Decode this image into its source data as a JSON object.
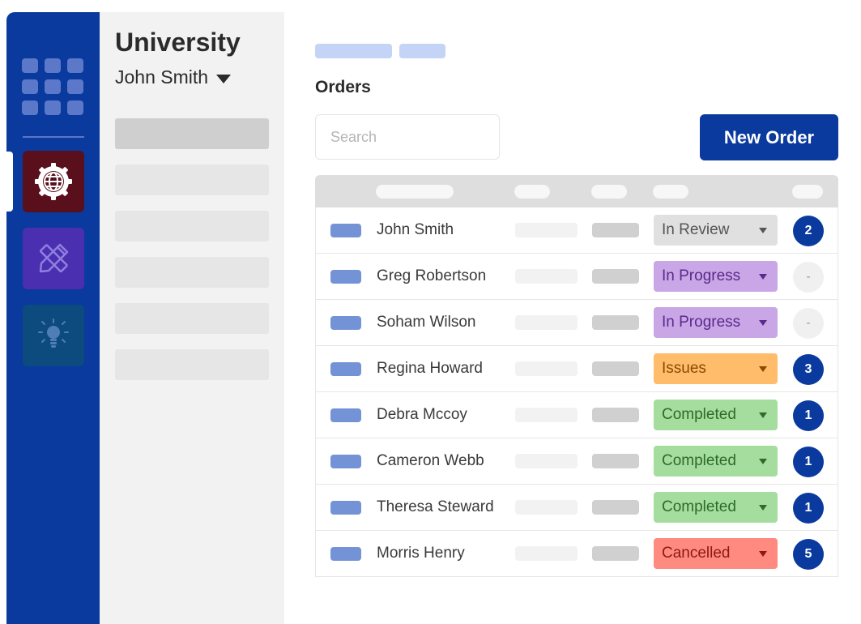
{
  "sidebar": {
    "org_title": "University",
    "user_name": "John Smith"
  },
  "main": {
    "title": "Orders",
    "search_placeholder": "Search",
    "new_order_label": "New Order"
  },
  "orders": [
    {
      "name": "John Smith",
      "status": "In Review",
      "count": "2"
    },
    {
      "name": "Greg Robertson",
      "status": "In Progress",
      "count": "-"
    },
    {
      "name": "Soham Wilson",
      "status": "In Progress",
      "count": "-"
    },
    {
      "name": "Regina Howard",
      "status": "Issues",
      "count": "3"
    },
    {
      "name": "Debra Mccoy",
      "status": "Completed",
      "count": "1"
    },
    {
      "name": "Cameron Webb",
      "status": "Completed",
      "count": "1"
    },
    {
      "name": "Theresa Steward",
      "status": "Completed",
      "count": "1"
    },
    {
      "name": "Morris Henry",
      "status": "Cancelled",
      "count": "5"
    }
  ],
  "status_colors": {
    "In Review": {
      "bg": "#e0e0e0",
      "fg": "#555555"
    },
    "In Progress": {
      "bg": "#c9a6e6",
      "fg": "#5a2a8c"
    },
    "Issues": {
      "bg": "#ffbd6b",
      "fg": "#8a4a00"
    },
    "Completed": {
      "bg": "#a4dd9e",
      "fg": "#2f6b28"
    },
    "Cancelled": {
      "bg": "#ff8a80",
      "fg": "#8c1a12"
    }
  },
  "colors": {
    "brand": "#0a3a9e",
    "sidebar_bg": "#f2f2f2"
  },
  "icons": [
    "apps-grid-icon",
    "globe-gear-icon",
    "ruler-pencil-icon",
    "lightbulb-icon"
  ]
}
